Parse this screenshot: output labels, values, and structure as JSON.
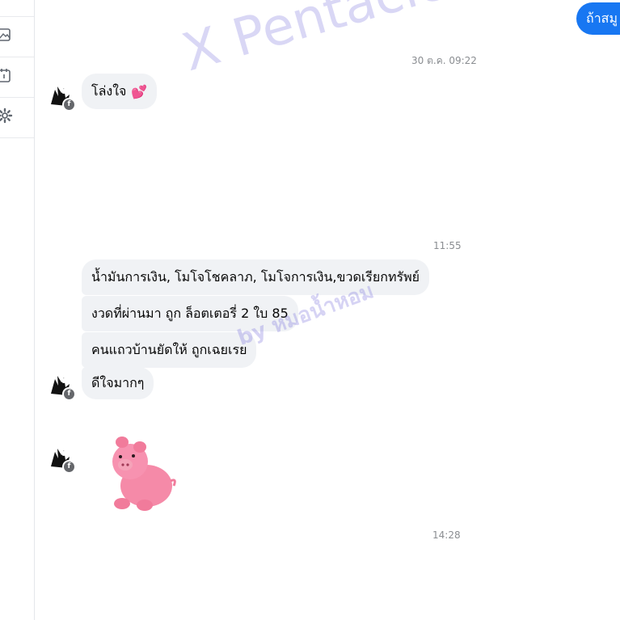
{
  "sidebar": {
    "icons": [
      "image-icon",
      "calendar-icon",
      "gear-icon"
    ]
  },
  "messages": {
    "outgoing_top": "ถ้าสมู",
    "ts1": "30 ต.ค. 09:22",
    "msg1": "โล่งใจ",
    "msg1_emoji": "💕",
    "ts2": "11:55",
    "msg2": "น้ำมันการเงิน, โมโจโชคลาภ, โมโจการเงิน,ขวดเรียกทรัพย์",
    "msg3": "งวดที่ผ่านมา ถูก ล็อตเตอรี่ 2 ใบ 85",
    "msg4": "คนแถวบ้านยัดให้ ถูกเฉยเรย",
    "msg5": "ดีใจมากๆ",
    "ts3": "14:28"
  },
  "watermark": {
    "main": "X Pentacles",
    "sub": "by หมอน้ำหอม"
  },
  "colors": {
    "accent": "#1877f2",
    "bubble_in": "#f0f2f5",
    "timestamp": "#8a8d91"
  }
}
